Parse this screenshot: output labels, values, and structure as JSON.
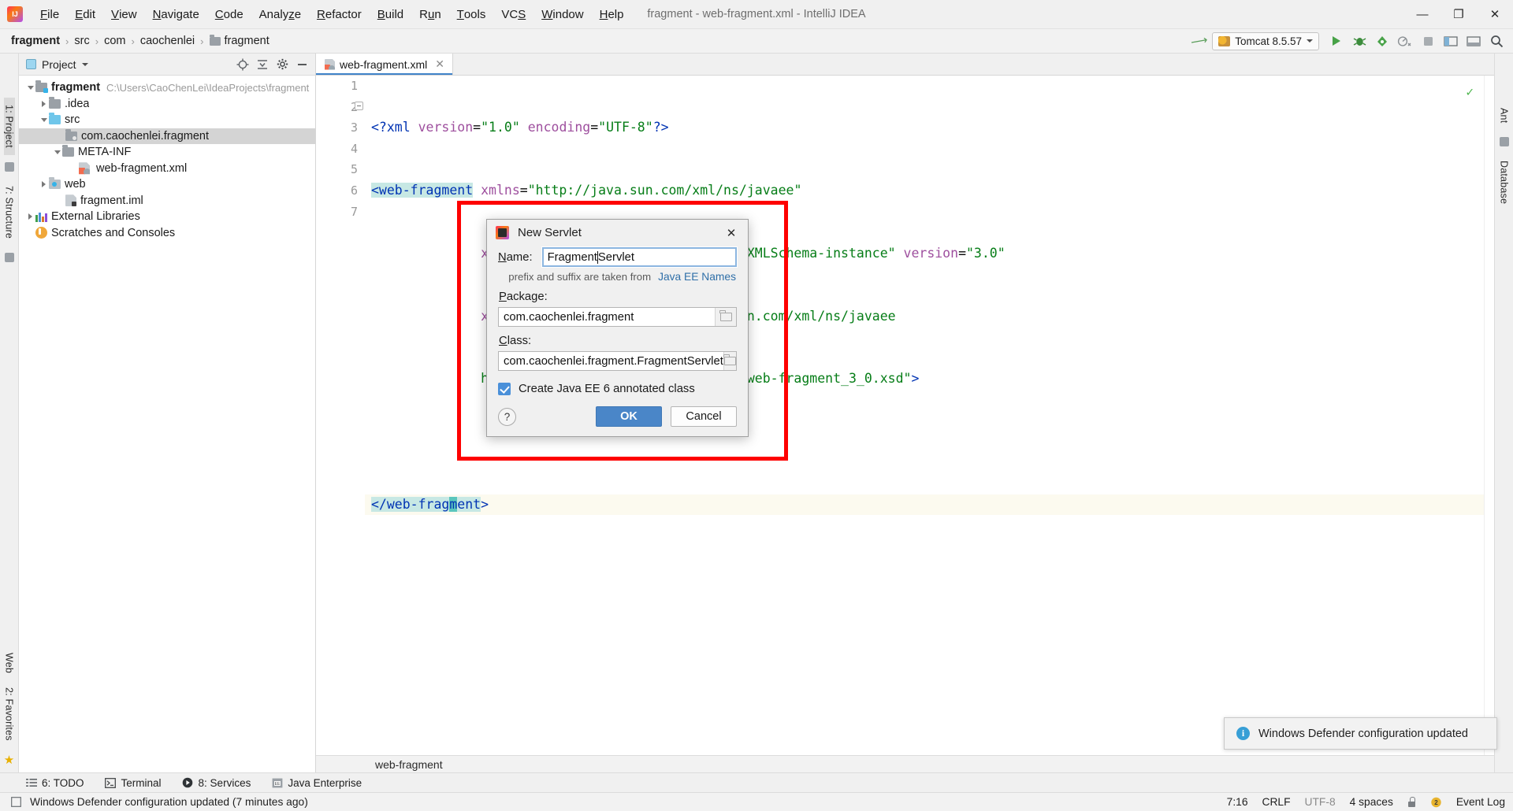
{
  "window": {
    "title": "fragment - web-fragment.xml - IntelliJ IDEA",
    "minimize": "—",
    "maximize": "❐",
    "close": "✕"
  },
  "menubar": [
    {
      "label": "File",
      "mnemonic": "F"
    },
    {
      "label": "Edit",
      "mnemonic": "E"
    },
    {
      "label": "View",
      "mnemonic": "V"
    },
    {
      "label": "Navigate",
      "mnemonic": "N"
    },
    {
      "label": "Code",
      "mnemonic": "C"
    },
    {
      "label": "Analyze",
      "mnemonic": "z"
    },
    {
      "label": "Refactor",
      "mnemonic": "R"
    },
    {
      "label": "Build",
      "mnemonic": "B"
    },
    {
      "label": "Run",
      "mnemonic": "u"
    },
    {
      "label": "Tools",
      "mnemonic": "T"
    },
    {
      "label": "VCS",
      "mnemonic": "S"
    },
    {
      "label": "Window",
      "mnemonic": "W"
    },
    {
      "label": "Help",
      "mnemonic": "H"
    }
  ],
  "breadcrumb": {
    "items": [
      "fragment",
      "src",
      "com",
      "caochenlei",
      "fragment"
    ],
    "separator": "›"
  },
  "toolbar": {
    "run_config": "Tomcat 8.5.57",
    "run_tooltip": "Run",
    "debug_tooltip": "Debug",
    "coverage_tooltip": "Run with Coverage",
    "profiler_tooltip": "Profiler",
    "stop_tooltip": "Stop",
    "search_tooltip": "Search Everywhere",
    "settings_tooltip": "Settings",
    "updates_tooltip": "Update Project"
  },
  "left_rail": {
    "tabs": [
      "1: Project",
      "7: Structure"
    ]
  },
  "right_rail": {
    "tabs": [
      "Ant",
      "Database"
    ]
  },
  "left_rail_bottom": {
    "tabs": [
      "Web",
      "2: Favorites"
    ]
  },
  "project_panel": {
    "title": "Project",
    "tree": [
      {
        "label": "fragment",
        "path": "C:\\Users\\CaoChenLei\\IdeaProjects\\fragment",
        "indent": 0,
        "twisty": "down",
        "icon": "module-folder",
        "bold": true,
        "selected": false
      },
      {
        "label": ".idea",
        "path": "",
        "indent": 1,
        "twisty": "right",
        "icon": "folder",
        "bold": false,
        "selected": false
      },
      {
        "label": "src",
        "path": "",
        "indent": 1,
        "twisty": "down",
        "icon": "source-folder",
        "bold": false,
        "selected": false
      },
      {
        "label": "com.caochenlei.fragment",
        "path": "",
        "indent": 2,
        "twisty": "none",
        "icon": "package",
        "bold": false,
        "selected": true
      },
      {
        "label": "META-INF",
        "path": "",
        "indent": 2,
        "twisty": "down",
        "icon": "folder",
        "bold": false,
        "selected": false
      },
      {
        "label": "web-fragment.xml",
        "path": "",
        "indent": 3,
        "twisty": "none",
        "icon": "xml-file",
        "bold": false,
        "selected": false
      },
      {
        "label": "web",
        "path": "",
        "indent": 1,
        "twisty": "right",
        "icon": "web-folder",
        "bold": false,
        "selected": false
      },
      {
        "label": "fragment.iml",
        "path": "",
        "indent": 2,
        "twisty": "none",
        "icon": "iml-file",
        "bold": false,
        "selected": false
      },
      {
        "label": "External Libraries",
        "path": "",
        "indent": 0,
        "twisty": "right",
        "icon": "library",
        "bold": false,
        "selected": false
      },
      {
        "label": "Scratches and Consoles",
        "path": "",
        "indent": 0,
        "twisty": "none",
        "icon": "scratch",
        "bold": false,
        "selected": false
      }
    ]
  },
  "editor": {
    "tab_label": "web-fragment.xml",
    "tab_close": "✕",
    "line_numbers": [
      "1",
      "2",
      "3",
      "4",
      "5",
      "6",
      "7"
    ],
    "breadcrumb_bottom": "web-fragment",
    "inspection_ok": "✓",
    "lines": [
      {
        "n": 1,
        "text": "<?xml version=\"1.0\" encoding=\"UTF-8\"?>"
      },
      {
        "n": 2,
        "text": "<web-fragment xmlns=\"http://java.sun.com/xml/ns/javaee\""
      },
      {
        "n": 3,
        "text": "              xmlns:xsi=\"http://www.w3.org/2001/XMLSchema-instance\" version=\"3.0\""
      },
      {
        "n": 4,
        "text": "              xsi:schemaLocation=\"http://java.sun.com/xml/ns/javaee"
      },
      {
        "n": 5,
        "text": "              http://java.sun.com/xml/ns/javaee/web-fragment_3_0.xsd\">"
      },
      {
        "n": 6,
        "text": ""
      },
      {
        "n": 7,
        "text": "</web-fragment>"
      }
    ]
  },
  "dialog": {
    "title": "New Servlet",
    "close": "✕",
    "name_label": "Name:",
    "name_mnemonic": "N",
    "name_value": "FragmentServlet",
    "name_caret_after": "Fragment",
    "hint": "prefix and suffix are taken from",
    "hint_link": "Java EE Names",
    "package_label": "Package:",
    "package_mnemonic": "P",
    "package_value": "com.caochenlei.fragment",
    "class_label": "Class:",
    "class_mnemonic": "C",
    "class_value": "com.caochenlei.fragment.FragmentServlet",
    "checkbox_label": "Create Java EE 6 annotated class",
    "checkbox_checked": true,
    "help_label": "?",
    "ok_label": "OK",
    "cancel_label": "Cancel"
  },
  "notification": {
    "text": "Windows Defender configuration updated",
    "icon": "info-icon"
  },
  "tool_window_bar": [
    {
      "label": "6: TODO",
      "mnemonic": "6",
      "icon": "todo-icon"
    },
    {
      "label": "Terminal",
      "mnemonic": "",
      "icon": "terminal-icon"
    },
    {
      "label": "8: Services",
      "mnemonic": "8",
      "icon": "services-icon"
    },
    {
      "label": "Java Enterprise",
      "mnemonic": "",
      "icon": "java-enterprise-icon"
    }
  ],
  "statusbar": {
    "message": "Windows Defender configuration updated (7 minutes ago)",
    "position": "7:16",
    "line_separator": "CRLF",
    "encoding": "UTF-8",
    "indent": "4 spaces",
    "event_log": "Event Log",
    "event_count": "2"
  }
}
